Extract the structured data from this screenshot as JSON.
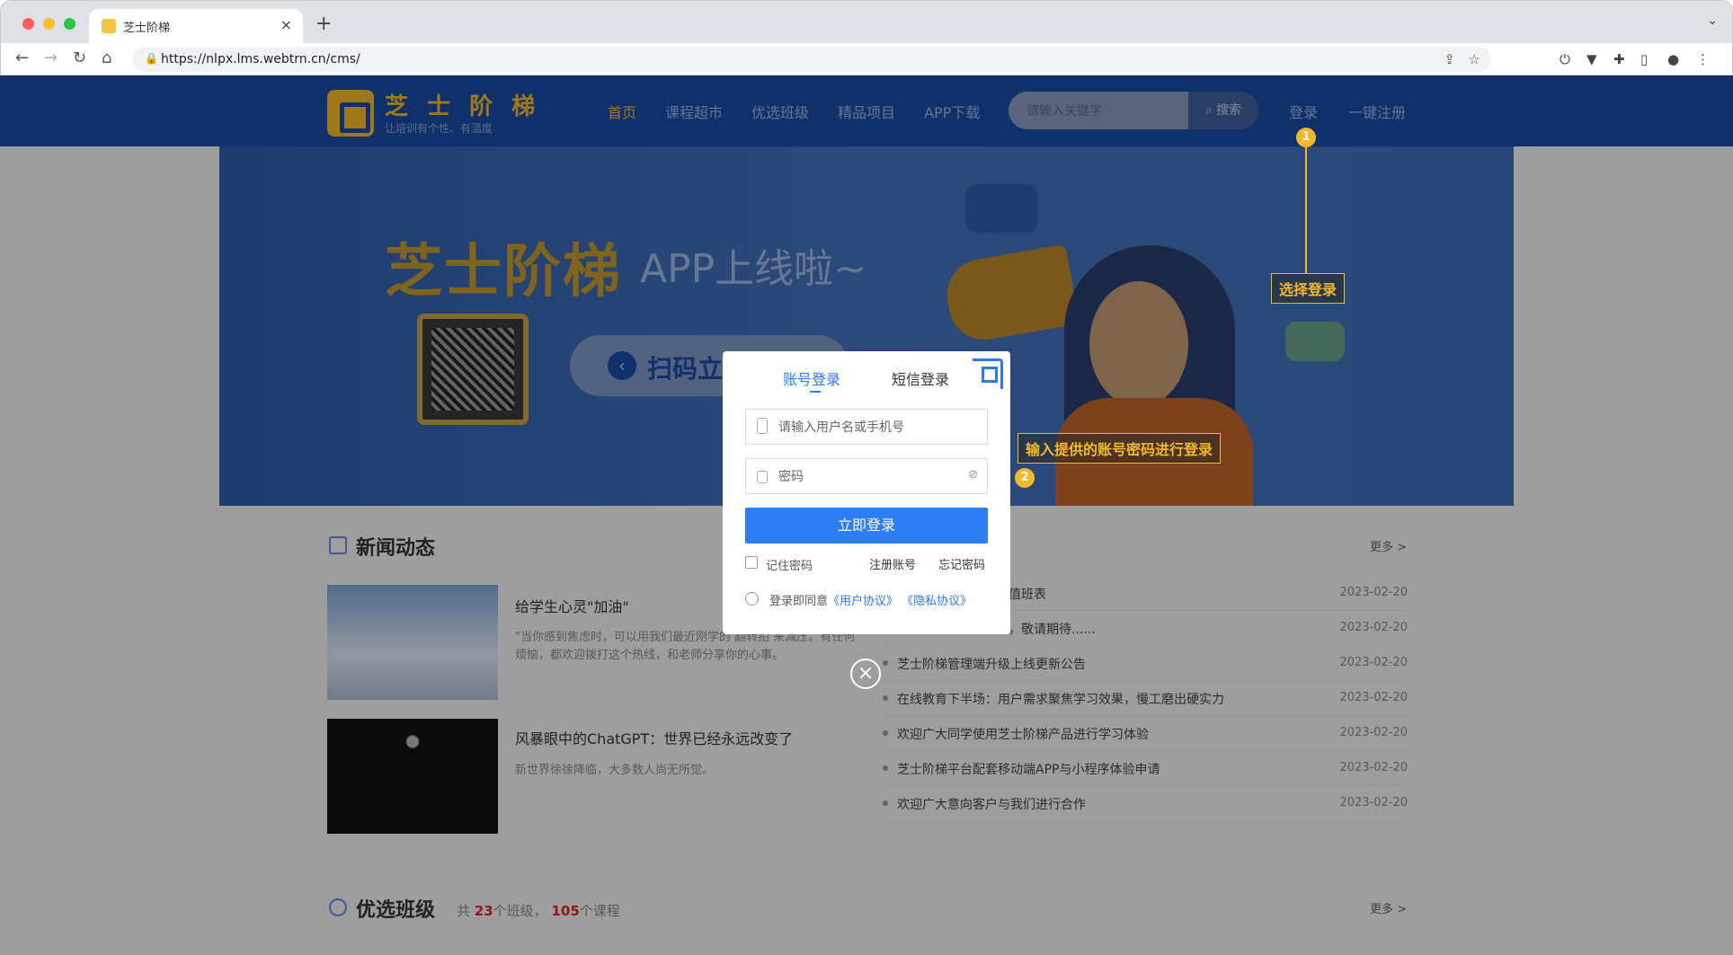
{
  "browser": {
    "tab_title": "芝士阶梯",
    "url": "https://nlpx.lms.webtrn.cn/cms/"
  },
  "header": {
    "logo_text": "芝 士 阶 梯",
    "logo_slogan": "让培训有个性、有温度",
    "menu": [
      "首页",
      "课程超市",
      "优选班级",
      "精品项目",
      "APP下载"
    ],
    "search_placeholder": "请输入关键字",
    "search_button": "搜索",
    "login": "登录",
    "register": "一键注册"
  },
  "banner": {
    "headline": "芝士阶梯",
    "app_text": "APP上线啦~",
    "scan_text": "扫码立"
  },
  "news": {
    "title": "新闻动态",
    "more": "更多 >",
    "items": [
      {
        "title": "给学生心灵\"加油\"",
        "desc": "\"当你感到焦虑时，可以用我们最近刚学的 翻转拍 来减压。有任何烦恼，都欢迎拨打这个热线，和老师分享你的心事。"
      },
      {
        "title": "风暴眼中的ChatGPT：世界已经永远改变了",
        "desc": "新世界徐徐降临，大多数人尚无所觉。"
      }
    ],
    "list": [
      {
        "text": "值班表",
        "date": "2023-02-20"
      },
      {
        "text": "，敬请期待......",
        "date": "2023-02-20"
      },
      {
        "text": "芝士阶梯管理端升级上线更新公告",
        "date": "2023-02-20"
      },
      {
        "text": "在线教育下半场：用户需求聚焦学习效果，慢工磨出硬实力",
        "date": "2023-02-20"
      },
      {
        "text": "欢迎广大同学使用芝士阶梯产品进行学习体验",
        "date": "2023-02-20"
      },
      {
        "text": "芝士阶梯平台配套移动端APP与小程序体验申请",
        "date": "2023-02-20"
      },
      {
        "text": "欢迎广大意向客户与我们进行合作",
        "date": "2023-02-20"
      }
    ]
  },
  "classes": {
    "title": "优选班级",
    "prefix": "共",
    "class_count": "23",
    "mid": "个班级，",
    "course_count": "105",
    "suffix": "个课程",
    "more": "更多 >"
  },
  "modal": {
    "tab_account": "账号登录",
    "tab_sms": "短信登录",
    "username_placeholder": "请输入用户名或手机号",
    "password_placeholder": "密码",
    "submit": "立即登录",
    "remember": "记住密码",
    "register": "注册账号",
    "forgot": "忘记密码",
    "agree_prefix": "登录即同意",
    "user_agreement": "《用户协议》",
    "privacy": "《隐私协议》"
  },
  "annotations": {
    "step1_badge": "1",
    "step1_label": "选择登录",
    "step2_badge": "2",
    "step2_label": "输入提供的账号密码进行登录"
  },
  "colors": {
    "brand_blue": "#1a4ba6",
    "brand_gold": "#f3b92a",
    "primary_button": "#2f7df4"
  }
}
